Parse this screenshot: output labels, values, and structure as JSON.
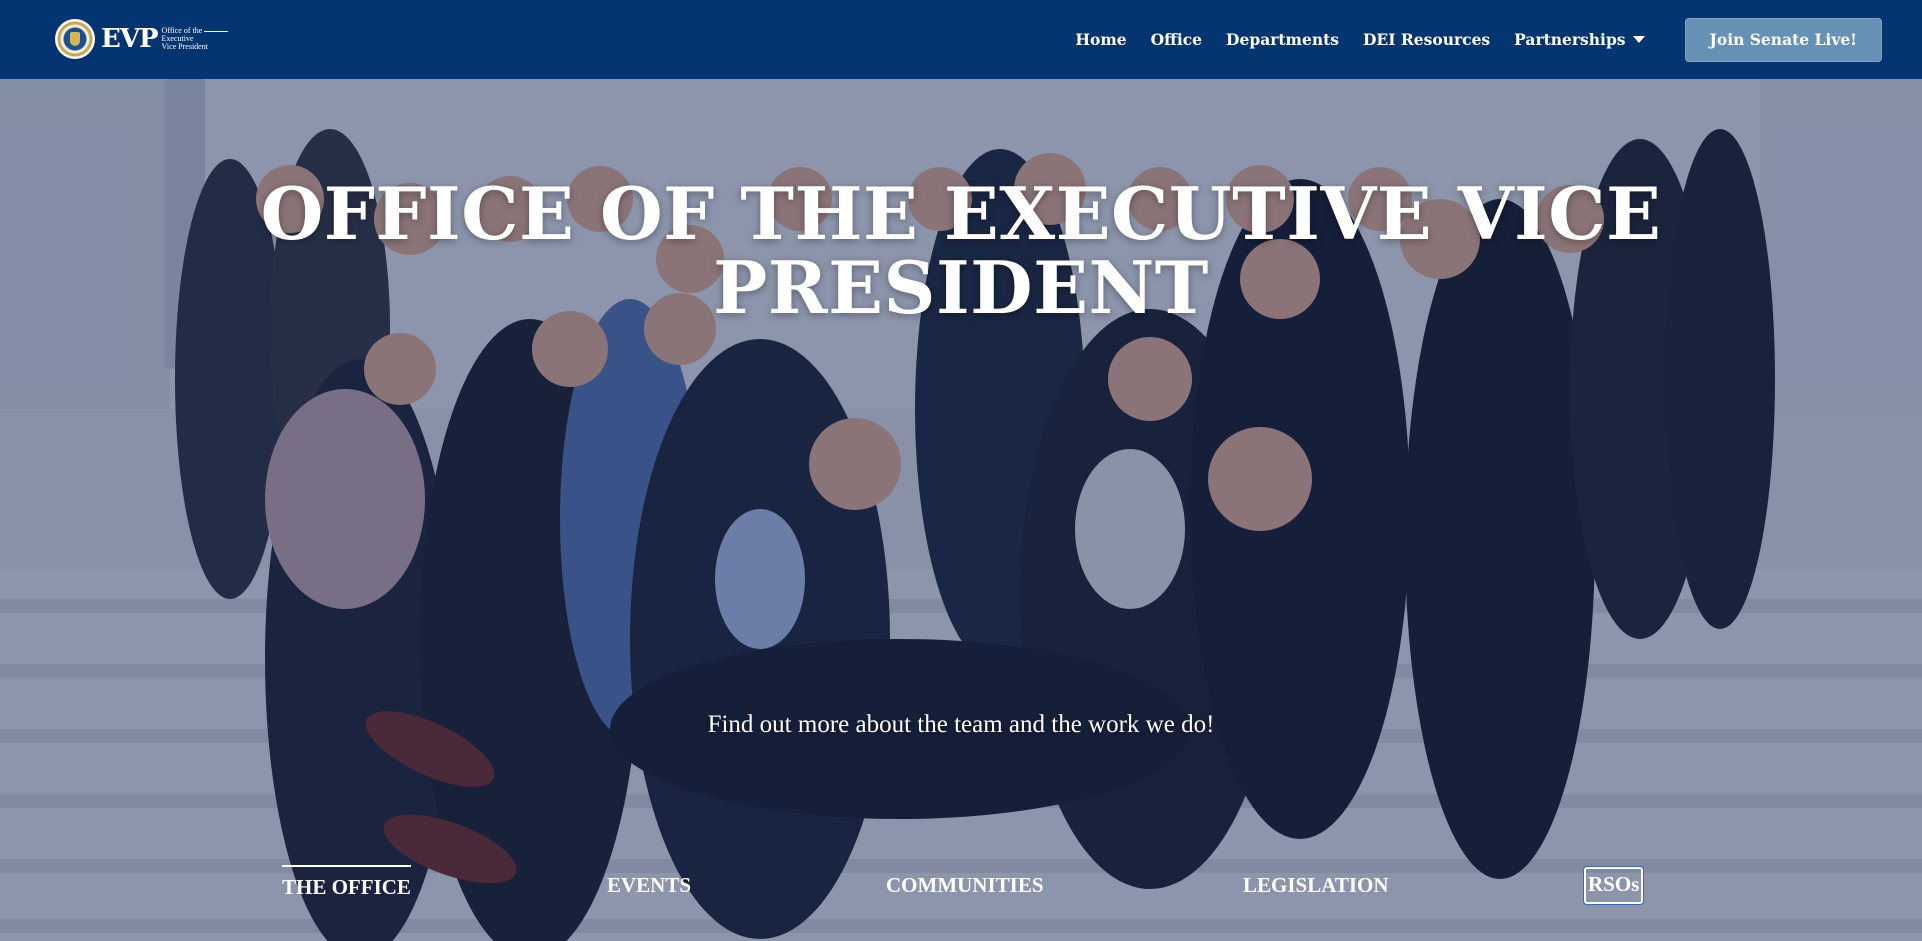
{
  "header": {
    "logo": {
      "evp_text": "EVP",
      "sub_lines": [
        "Office of the",
        "Executive",
        "Vice President"
      ]
    },
    "nav": [
      {
        "label": "Home"
      },
      {
        "label": "Office"
      },
      {
        "label": "Departments"
      },
      {
        "label": "DEI Resources"
      },
      {
        "label": "Partnerships",
        "icon": "chevron-down-icon"
      }
    ],
    "cta_label": "Join Senate Live!"
  },
  "hero": {
    "title_line1": "OFFICE OF THE EXECUTIVE VICE",
    "title_line2": "PRESIDENT",
    "subtitle": "Find out more about the team and the work we do!",
    "background": "group-photo-of-office-team-on-steps"
  },
  "tabs": [
    {
      "label": "THE OFFICE",
      "active": true
    },
    {
      "label": "EVENTS"
    },
    {
      "label": "COMMUNITIES"
    },
    {
      "label": "LEGISLATION"
    },
    {
      "label": "RSOs",
      "focused": true
    }
  ],
  "colors": {
    "nav_bg": "#053570",
    "cta_bg": "#6591b4",
    "overlay": "#14285a"
  }
}
